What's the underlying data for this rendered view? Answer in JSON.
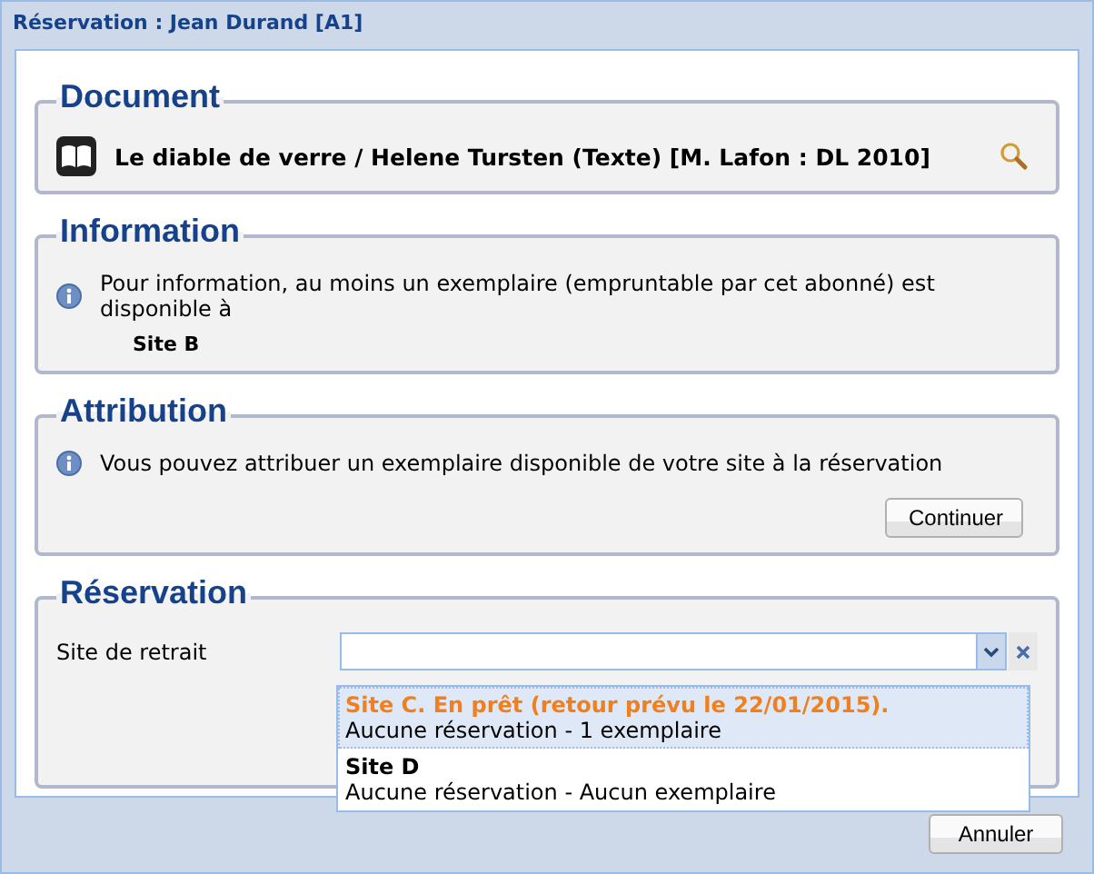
{
  "window": {
    "title": "Réservation : Jean Durand [A1]"
  },
  "document": {
    "legend": "Document",
    "title": "Le diable de verre / Helene Tursten (Texte) [M. Lafon : DL 2010]"
  },
  "information": {
    "legend": "Information",
    "message": "Pour information, au moins un exemplaire (empruntable par cet abonné) est disponible à",
    "site": "Site B"
  },
  "attribution": {
    "legend": "Attribution",
    "message": "Vous pouvez attribuer un exemplaire disponible de votre site à la réservation",
    "button": "Continuer"
  },
  "reservation": {
    "legend": "Réservation",
    "field_label": "Site de retrait",
    "dropdown": {
      "expanded": true,
      "options": [
        {
          "title": "Site C. En prêt (retour prévu le 22/01/2015).",
          "detail": "Aucune réservation - 1 exemplaire",
          "color": "#f07f1d",
          "selected": true
        },
        {
          "title": "Site D",
          "detail": "Aucune réservation - Aucun exemplaire",
          "color": "#000000",
          "selected": false
        }
      ]
    }
  },
  "footer": {
    "button": "Annuler"
  }
}
